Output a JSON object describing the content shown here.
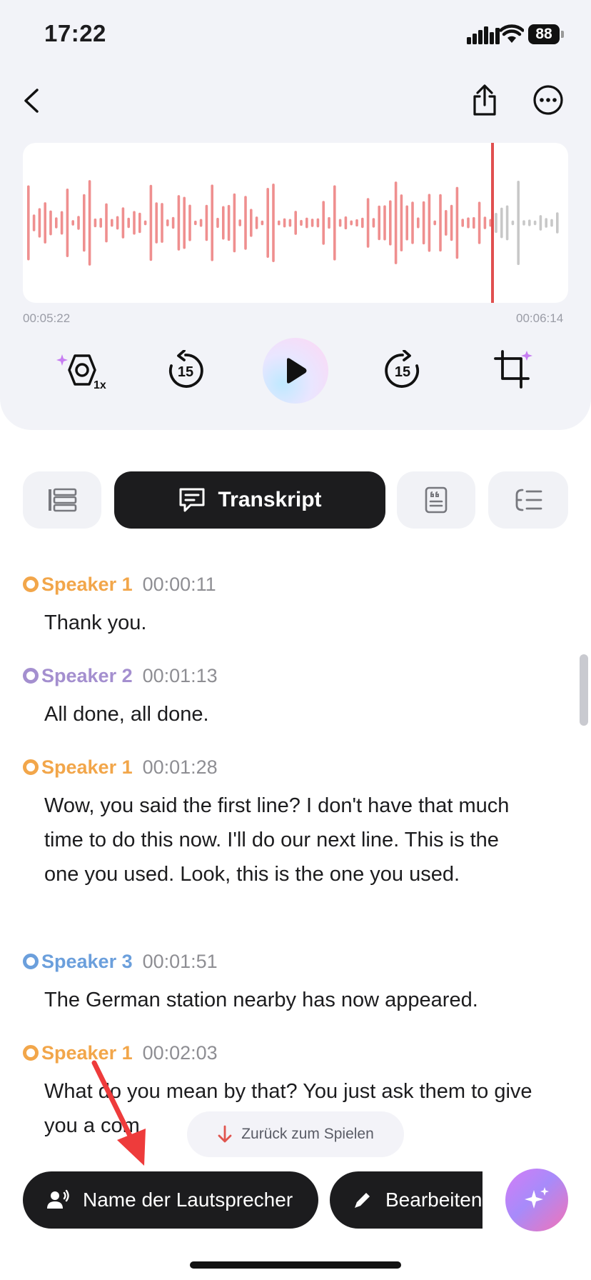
{
  "status_bar": {
    "time": "17:22",
    "battery": "88"
  },
  "player": {
    "time_start": "00:05:22",
    "time_end": "00:06:14",
    "speed_label": "1x",
    "skip_back_label": "15",
    "skip_forward_label": "15",
    "colors": {
      "played": "#ef8f8f",
      "unplayed": "#c8c8c8",
      "playhead": "#e05050"
    }
  },
  "tabs": [
    {
      "label": ""
    },
    {
      "label": "Transkript"
    },
    {
      "label": ""
    },
    {
      "label": ""
    }
  ],
  "transcript": [
    {
      "speaker": "Speaker 1",
      "time": "00:00:11",
      "text": "Thank you.",
      "color": "#f2a64a"
    },
    {
      "speaker": "Speaker 2",
      "time": "00:01:13",
      "text": "All done, all done.",
      "color": "#a48fcf"
    },
    {
      "speaker": "Speaker 1",
      "time": "00:01:28",
      "text": "Wow, you said the first line? I don't have that much time to do this now. I'll do our next line. This is the one you used. Look, this is the one you used.",
      "color": "#f2a64a"
    },
    {
      "speaker": "Speaker 3",
      "time": "00:01:51",
      "text": "The German station nearby has now appeared.",
      "color": "#6b9fdc"
    },
    {
      "speaker": "Speaker 1",
      "time": "00:02:03",
      "text": "What do you mean by that? You just ask them to give you a com",
      "color": "#f2a64a"
    }
  ],
  "actions": {
    "return_to_play": "Zurück zum Spielen",
    "speaker_names": "Name der Lautsprecher",
    "edit": "Bearbeiten"
  }
}
